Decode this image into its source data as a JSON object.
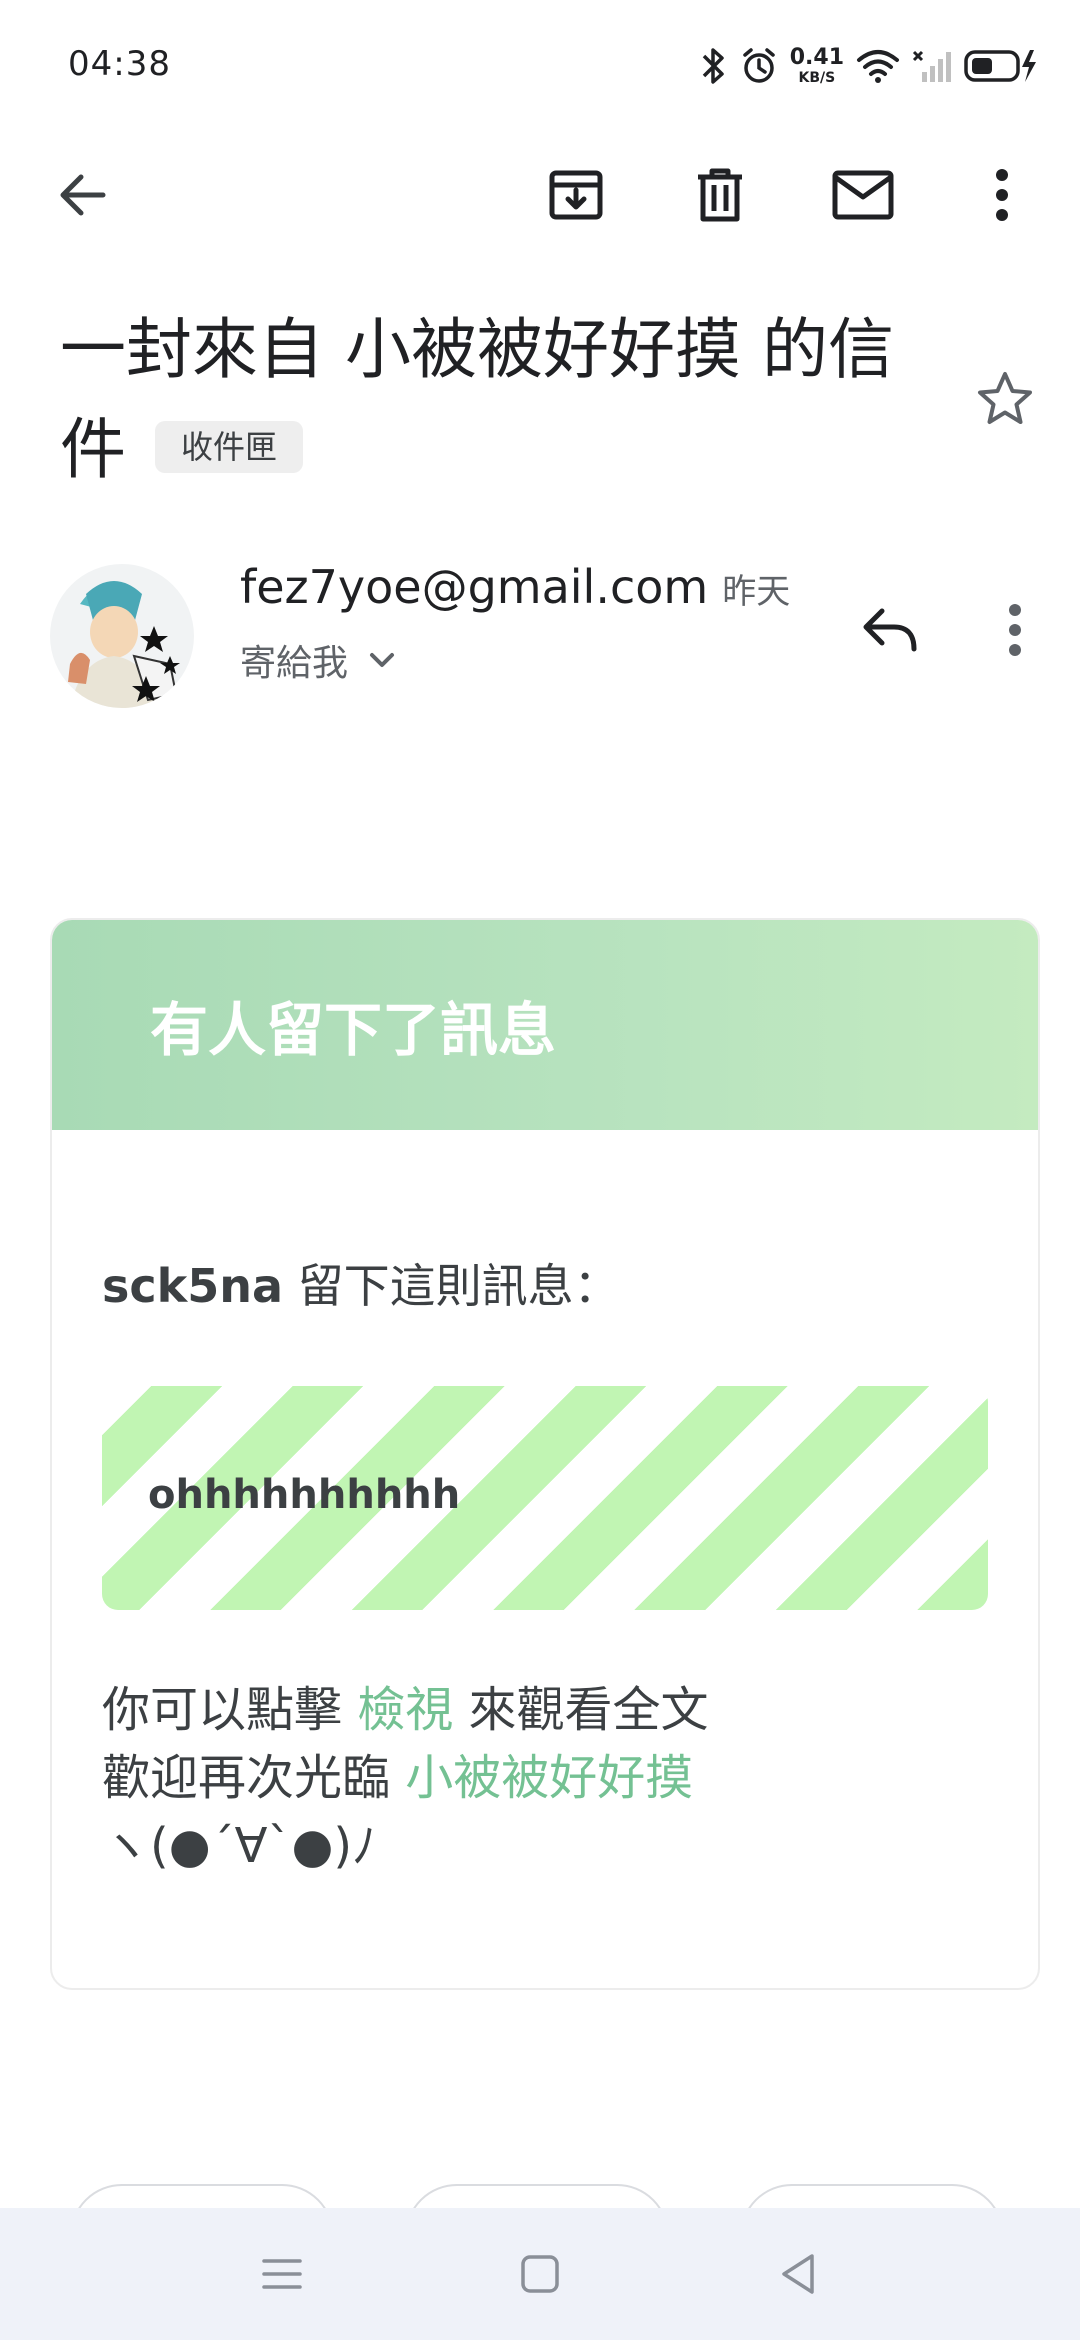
{
  "status_bar": {
    "time": "04:38",
    "net_speed_value": "0.41",
    "net_speed_unit": "KB/S"
  },
  "toolbar": {
    "back_icon": "arrow-left-icon",
    "archive_icon": "archive-icon",
    "delete_icon": "trash-icon",
    "mark_unread_icon": "mail-icon",
    "more_icon": "more-vertical-icon"
  },
  "email": {
    "subject": "一封來自 小被被好好摸 的信件",
    "folder_badge": "收件匣",
    "sender_email": "fez7yoe@gmail.com",
    "date": "昨天",
    "recipient_label": "寄給我"
  },
  "card": {
    "header_title": "有人留下了訊息",
    "author": "sck5na",
    "author_suffix": " 留下這則訊息：",
    "message": "ohhhhhhhhhh",
    "line1_prefix": "你可以點擊 ",
    "line1_link": "檢視",
    "line1_suffix": " 來觀看全文",
    "line2_prefix": "歡迎再次光臨 ",
    "line2_link": "小被被好好摸",
    "line3": "ヽ(●´∀`●)ﾉ"
  },
  "colors": {
    "header_gradient_start": "#a8dab5",
    "header_gradient_end": "#c4ebc0",
    "stripe_green": "#c1f5b3",
    "link_green": "#74c193",
    "nav_bar_bg": "#eff2f9"
  }
}
